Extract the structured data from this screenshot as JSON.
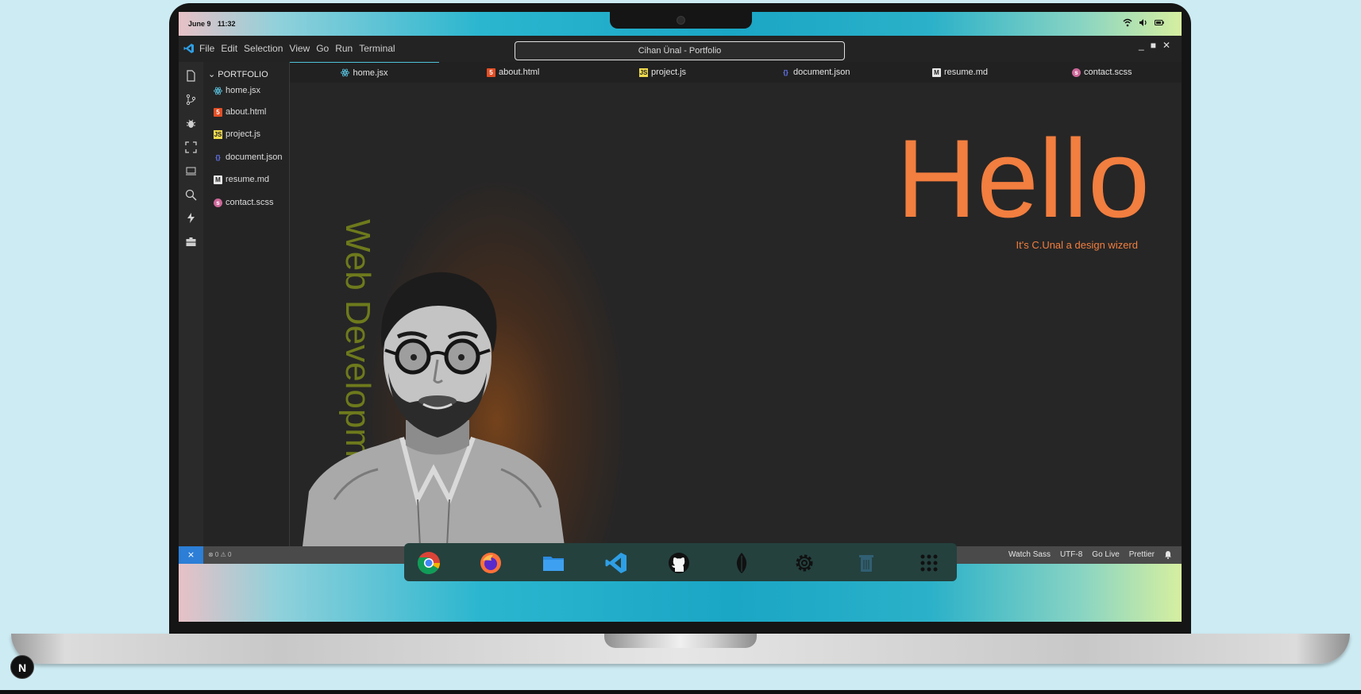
{
  "system": {
    "date": "June 9",
    "time": "11:32"
  },
  "ide": {
    "menu": [
      "File",
      "Edit",
      "Selection",
      "View",
      "Go",
      "Run",
      "Terminal"
    ],
    "search_title": "Cihan Ünal - Portfolio",
    "window_controls": [
      "_",
      "■",
      "✕"
    ],
    "explorer": {
      "heading": "PORTFOLIO",
      "files": [
        {
          "name": "home.jsx",
          "icon": "react-icon"
        },
        {
          "name": "about.html",
          "icon": "html5-icon"
        },
        {
          "name": "project.js",
          "icon": "javascript-icon"
        },
        {
          "name": "document.json",
          "icon": "json-icon"
        },
        {
          "name": "resume.md",
          "icon": "markdown-icon"
        },
        {
          "name": "contact.scss",
          "icon": "sass-icon"
        }
      ]
    },
    "tabs": [
      {
        "name": "home.jsx",
        "active": true
      },
      {
        "name": "about.html",
        "active": false
      },
      {
        "name": "project.js",
        "active": false
      },
      {
        "name": "document.json",
        "active": false
      },
      {
        "name": "resume.md",
        "active": false
      },
      {
        "name": "contact.scss",
        "active": false
      }
    ],
    "editor": {
      "headline": "Hello",
      "tagline": "It's C.Unal a design wizerd",
      "vertical_text": "Web Development"
    },
    "statusbar": {
      "left": "⊗ 0  ⚠ 0",
      "right": [
        "Watch Sass",
        "UTF-8",
        "Go Live",
        "Prettier"
      ]
    }
  },
  "dock": [
    "chrome-icon",
    "firefox-icon",
    "files-icon",
    "vscode-icon",
    "github-icon",
    "mongodb-icon",
    "settings-icon",
    "trash-icon",
    "apps-grid-icon"
  ],
  "badge": "N",
  "colors": {
    "accent_orange": "#f27e3f",
    "vertical_text": "#6e7a1c",
    "remote_blue": "#2c7ed6"
  }
}
